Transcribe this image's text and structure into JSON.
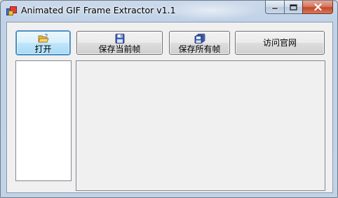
{
  "window": {
    "title": "Animated GIF Frame Extractor v1.1",
    "icon": "app-gif-icon"
  },
  "caption_buttons": {
    "minimize_icon": "minimize-icon",
    "maximize_icon": "maximize-icon",
    "close_icon": "close-icon"
  },
  "toolbar": {
    "open_label": "打开",
    "open_icon": "open-folder-icon",
    "save_current_label": "保存当前帧",
    "save_current_icon": "floppy-disk-icon",
    "save_all_label": "保存所有帧",
    "save_all_icon": "multiple-disks-icon",
    "website_label": "访问官网"
  },
  "colors": {
    "focus_border": "#3c7fb1",
    "client_background": "#f0f0f0",
    "close_button": "#c2482a"
  }
}
